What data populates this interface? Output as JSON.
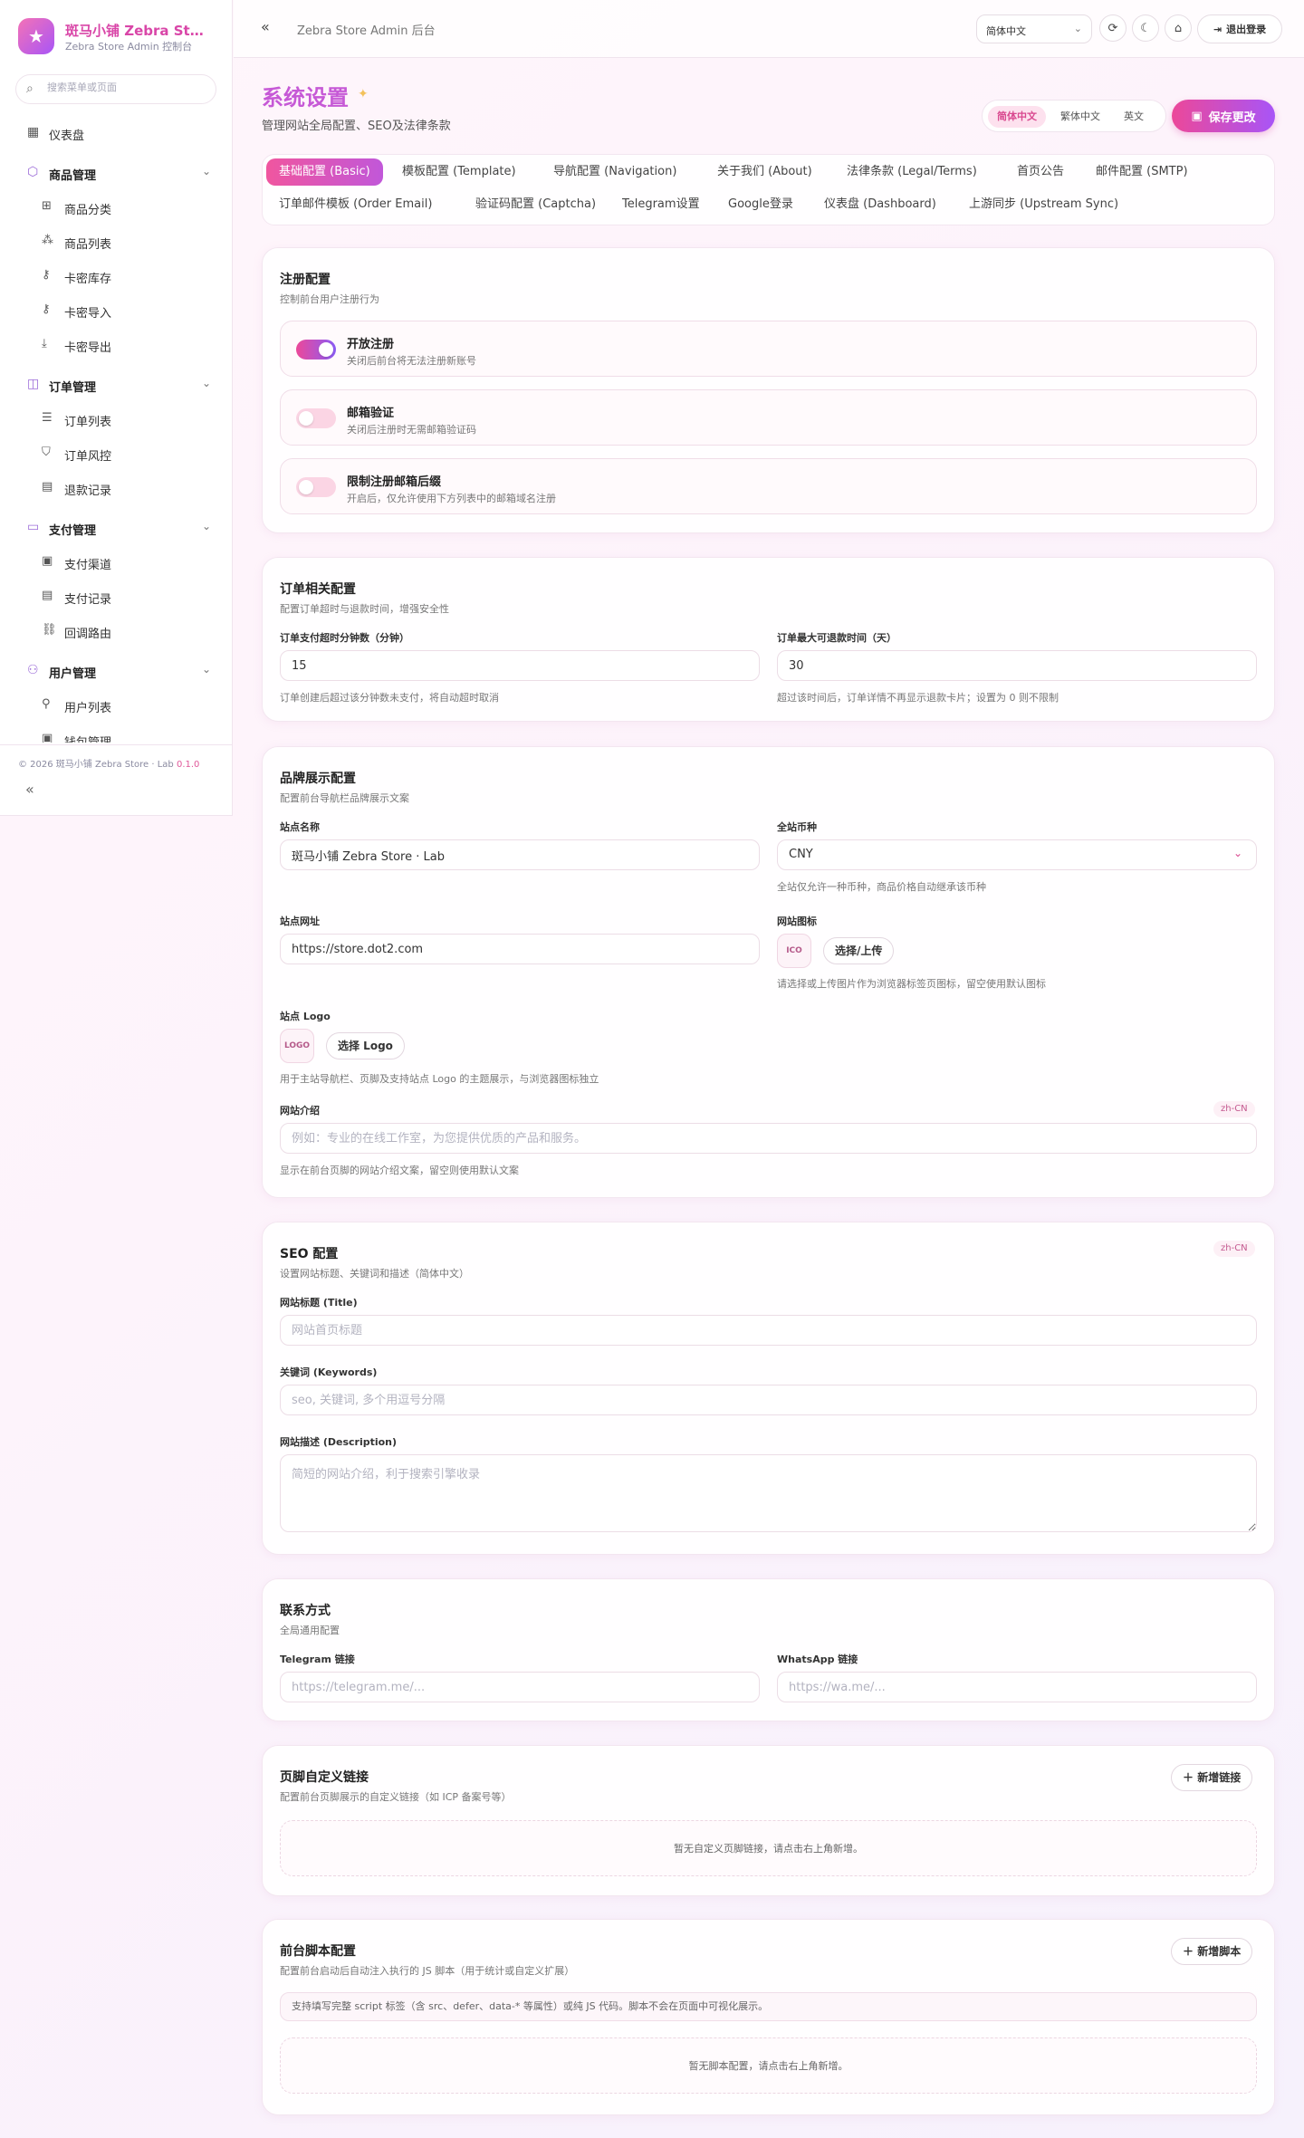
{
  "brand": {
    "name": "斑马小铺 Zebra Store · Lab",
    "subtitle": "Zebra Store Admin 控制台"
  },
  "sidebar": {
    "search_placeholder": "搜索菜单或页面",
    "dashboard": "仪表盘",
    "groups": [
      {
        "label": "商品管理",
        "items": [
          "商品分类",
          "商品列表",
          "卡密库存",
          "卡密导入",
          "卡密导出"
        ]
      },
      {
        "label": "订单管理",
        "items": [
          "订单列表",
          "订单风控",
          "退款记录"
        ]
      },
      {
        "label": "支付管理",
        "items": [
          "支付渠道",
          "支付记录",
          "回调路由"
        ]
      },
      {
        "label": "用户管理",
        "items": [
          "用户列表",
          "钱包管理"
        ]
      }
    ],
    "footer_text": "© 2026 斑马小铺 Zebra Store · Lab",
    "footer_version": "0.1.0"
  },
  "topbar": {
    "title": "Zebra Store Admin 后台",
    "language": "简体中文",
    "logout": "退出登录"
  },
  "header": {
    "title": "系统设置",
    "subtitle": "管理网站全局配置、SEO及法律条款",
    "lang_tabs": [
      "简体中文",
      "繁体中文",
      "英文"
    ],
    "save": "保存更改"
  },
  "tabs": [
    "基础配置 (Basic)",
    "模板配置 (Template)",
    "导航配置 (Navigation)",
    "关于我们 (About)",
    "法律条款 (Legal/Terms)",
    "首页公告",
    "邮件配置 (SMTP)",
    "订单邮件模板 (Order Email)",
    "验证码配置 (Captcha)",
    "Telegram设置",
    "Google登录",
    "仪表盘 (Dashboard)",
    "上游同步 (Upstream Sync)"
  ],
  "registration": {
    "title": "注册配置",
    "subtitle": "控制前台用户注册行为",
    "items": [
      {
        "title": "开放注册",
        "desc": "关闭后前台将无法注册新账号",
        "on": true
      },
      {
        "title": "邮箱验证",
        "desc": "关闭后注册时无需邮箱验证码",
        "on": false
      },
      {
        "title": "限制注册邮箱后缀",
        "desc": "开启后，仅允许使用下方列表中的邮箱域名注册",
        "on": false
      }
    ]
  },
  "order": {
    "title": "订单相关配置",
    "subtitle": "配置订单超时与退款时间，增强安全性",
    "timeout_label": "订单支付超时分钟数（分钟）",
    "timeout_value": "15",
    "timeout_hint": "订单创建后超过该分钟数未支付，将自动超时取消",
    "refund_label": "订单最大可退款时间（天）",
    "refund_value": "30",
    "refund_hint": "超过该时间后，订单详情不再显示退款卡片；设置为 0 则不限制"
  },
  "brand_config": {
    "title": "品牌展示配置",
    "subtitle": "配置前台导航栏品牌展示文案",
    "site_name_label": "站点名称",
    "site_name_value": "斑马小铺 Zebra Store · Lab",
    "currency_label": "全站币种",
    "currency_value": "CNY",
    "currency_hint": "全站仅允许一种币种，商品价格自动继承该币种",
    "site_url_label": "站点网址",
    "site_url_value": "https://store.dot2.com",
    "favicon_label": "网站图标",
    "favicon_box": "ICO",
    "favicon_button": "选择/上传",
    "favicon_hint": "请选择或上传图片作为浏览器标签页图标，留空使用默认图标",
    "logo_label": "站点 Logo",
    "logo_box": "LOGO",
    "logo_button": "选择 Logo",
    "logo_hint": "用于主站导航栏、页脚及支持站点 Logo 的主题展示，与浏览器图标独立",
    "intro_label": "网站介绍",
    "intro_badge": "zh-CN",
    "intro_placeholder": "例如：专业的在线工作室，为您提供优质的产品和服务。",
    "intro_hint": "显示在前台页脚的网站介绍文案，留空则使用默认文案"
  },
  "seo": {
    "title": "SEO 配置",
    "subtitle": "设置网站标题、关键词和描述（简体中文）",
    "badge": "zh-CN",
    "title_label": "网站标题 (Title)",
    "title_placeholder": "网站首页标题",
    "keywords_label": "关键词 (Keywords)",
    "keywords_placeholder": "seo, 关键词, 多个用逗号分隔",
    "desc_label": "网站描述 (Description)",
    "desc_placeholder": "简短的网站介绍，利于搜索引擎收录"
  },
  "contact": {
    "title": "联系方式",
    "subtitle": "全局通用配置",
    "telegram_label": "Telegram 链接",
    "telegram_placeholder": "https://telegram.me/...",
    "whatsapp_label": "WhatsApp 链接",
    "whatsapp_placeholder": "https://wa.me/..."
  },
  "footer_links": {
    "title": "页脚自定义链接",
    "subtitle": "配置前台页脚展示的自定义链接（如 ICP 备案号等）",
    "add": "新增链接",
    "empty": "暂无自定义页脚链接，请点击右上角新增。"
  },
  "scripts": {
    "title": "前台脚本配置",
    "subtitle": "配置前台启动后自动注入执行的 JS 脚本（用于统计或自定义扩展）",
    "add": "新增脚本",
    "note": "支持填写完整 script 标签（含 src、defer、data-* 等属性）或纯 JS 代码。脚本不会在页面中可视化展示。",
    "empty": "暂无脚本配置，请点击右上角新增。"
  },
  "colors": {
    "accent": "#d946a8",
    "accent2": "#a855f7",
    "toggle_off": "#fbd5e4"
  }
}
